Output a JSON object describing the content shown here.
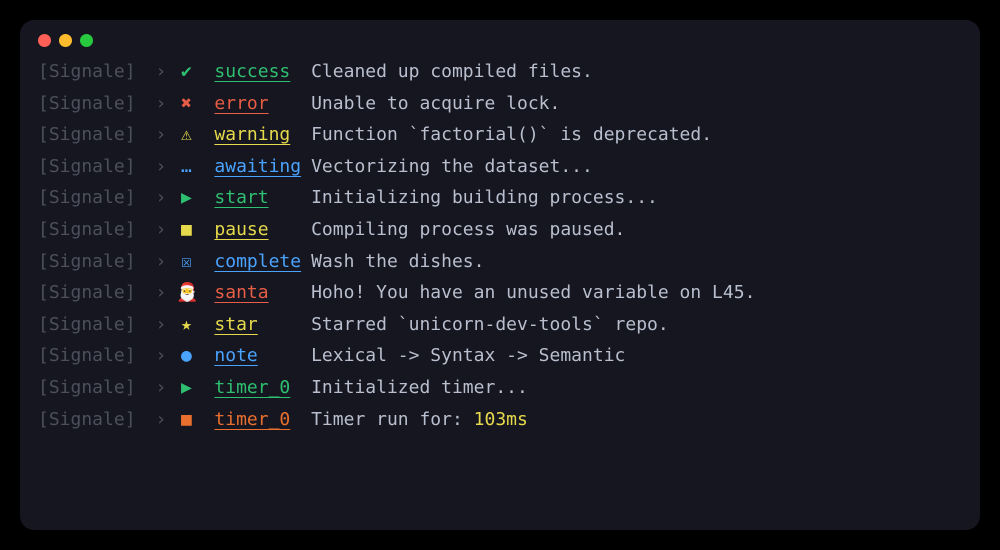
{
  "window": {
    "traffic_lights": [
      "#ff5f56",
      "#ffbd2e",
      "#27c93f"
    ]
  },
  "prefix": "[Signale]",
  "chevron": "›",
  "lines": [
    {
      "icon_name": "check-icon",
      "icon": "✔",
      "icon_color": "#2fbf71",
      "badge": "success",
      "badge_color": "#2fbf71",
      "message": "Cleaned up compiled files."
    },
    {
      "icon_name": "cross-icon",
      "icon": "✖",
      "icon_color": "#e85d45",
      "badge": "error",
      "badge_color": "#e85d45",
      "message": "Unable to acquire lock."
    },
    {
      "icon_name": "warning-icon",
      "icon": "⚠",
      "icon_color": "#e6d94c",
      "badge": "warning",
      "badge_color": "#e6d94c",
      "message": "Function `factorial()` is deprecated."
    },
    {
      "icon_name": "ellipsis-icon",
      "icon": "…",
      "icon_color": "#4aa3ff",
      "badge": "awaiting",
      "badge_color": "#4aa3ff",
      "message": "Vectorizing the dataset..."
    },
    {
      "icon_name": "play-icon",
      "icon": "▶",
      "icon_color": "#2fbf71",
      "badge": "start",
      "badge_color": "#2fbf71",
      "message": "Initializing building process..."
    },
    {
      "icon_name": "pause-icon",
      "icon": "■",
      "icon_color": "#e6d94c",
      "badge": "pause",
      "badge_color": "#e6d94c",
      "message": "Compiling process was paused."
    },
    {
      "icon_name": "checkbox-icon",
      "icon": "☒",
      "icon_color": "#4aa3ff",
      "badge": "complete",
      "badge_color": "#4aa3ff",
      "message": "Wash the dishes."
    },
    {
      "icon_name": "santa-icon",
      "icon": "🎅",
      "icon_color": "#e85d45",
      "badge": "santa",
      "badge_color": "#e85d45",
      "message": "Hoho! You have an unused variable on L45."
    },
    {
      "icon_name": "star-icon",
      "icon": "★",
      "icon_color": "#e6d94c",
      "badge": "star",
      "badge_color": "#e6d94c",
      "message": "Starred `unicorn-dev-tools` repo."
    },
    {
      "icon_name": "dot-icon",
      "icon": "●",
      "icon_color": "#4aa3ff",
      "badge": "note",
      "badge_color": "#4aa3ff",
      "message": "Lexical -> Syntax -> Semantic"
    },
    {
      "icon_name": "play-icon",
      "icon": "▶",
      "icon_color": "#2fbf71",
      "badge": "timer_0",
      "badge_color": "#2fbf71",
      "message": "Initialized timer..."
    },
    {
      "icon_name": "stop-icon",
      "icon": "■",
      "icon_color": "#e86f2e",
      "badge": "timer_0",
      "badge_color": "#e86f2e",
      "message": "Timer run for: ",
      "highlight": "103ms"
    }
  ]
}
